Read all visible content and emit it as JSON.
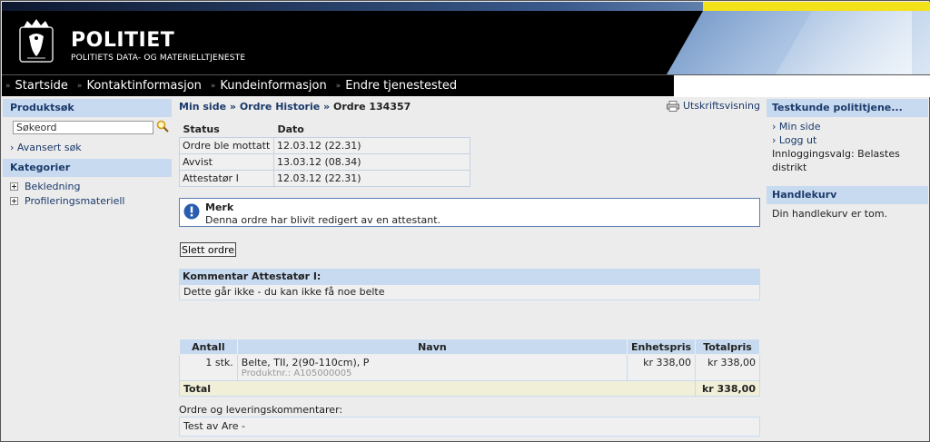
{
  "header": {
    "title": "POLITIET",
    "subtitle": "POLITIETS DATA- OG MATERIELLTJENESTE"
  },
  "nav": {
    "items": [
      "Startside",
      "Kontaktinformasjon",
      "Kundeinformasjon",
      "Endre tjenestested"
    ]
  },
  "left": {
    "search_heading": "Produktsøk",
    "search_value": "Søkeord",
    "advanced_search": "Avansert søk",
    "categories_heading": "Kategorier",
    "categories": [
      "Bekledning",
      "Profileringsmateriell"
    ]
  },
  "main": {
    "breadcrumb": {
      "min_side": "Min side",
      "ordre_historie": "Ordre Historie",
      "current": "Ordre 134357",
      "sep": "»"
    },
    "print_label": "Utskriftsvisning",
    "status_table": {
      "headers": [
        "Status",
        "Dato"
      ],
      "rows": [
        [
          "Ordre ble mottatt",
          "12.03.12 (22.31)"
        ],
        [
          "Avvist",
          "13.03.12 (08.34)"
        ],
        [
          "Attestatør I",
          "12.03.12 (22.31)"
        ]
      ]
    },
    "notice": {
      "title": "Merk",
      "text": "Denna ordre har blivit redigert av en attestant."
    },
    "delete_button": "Slett ordre",
    "comment": {
      "heading": "Kommentar Attestatør I:",
      "text": "Dette går ikke - du kan ikke få noe belte"
    },
    "items_table": {
      "headers": [
        "Antall",
        "Navn",
        "Enhetspris",
        "Totalpris"
      ],
      "rows": [
        {
          "antall": "1 stk.",
          "navn": "Belte, TII, 2(90-110cm), P",
          "produktnr": "Produktnr.: A105000005",
          "enhetspris": "kr 338,00",
          "totalpris": "kr 338,00"
        }
      ],
      "total_label": "Total",
      "total_value": "kr 338,00"
    },
    "order_comments_label": "Ordre og leveringskommentarer:",
    "order_comments_text": "Test av Are -"
  },
  "right": {
    "customer_heading": "Testkunde polititjene...",
    "links": [
      "Min side",
      "Logg ut"
    ],
    "login_choice": "Innloggingsvalg: Belastes distrikt",
    "cart_heading": "Handlekurv",
    "cart_text": "Din handlekurv er tom."
  },
  "colors": {
    "header_bg": "#000000",
    "accent_yellow": "#f3e21a",
    "box_header_bg": "#c8daef",
    "link_blue": "#1b3a6b"
  }
}
